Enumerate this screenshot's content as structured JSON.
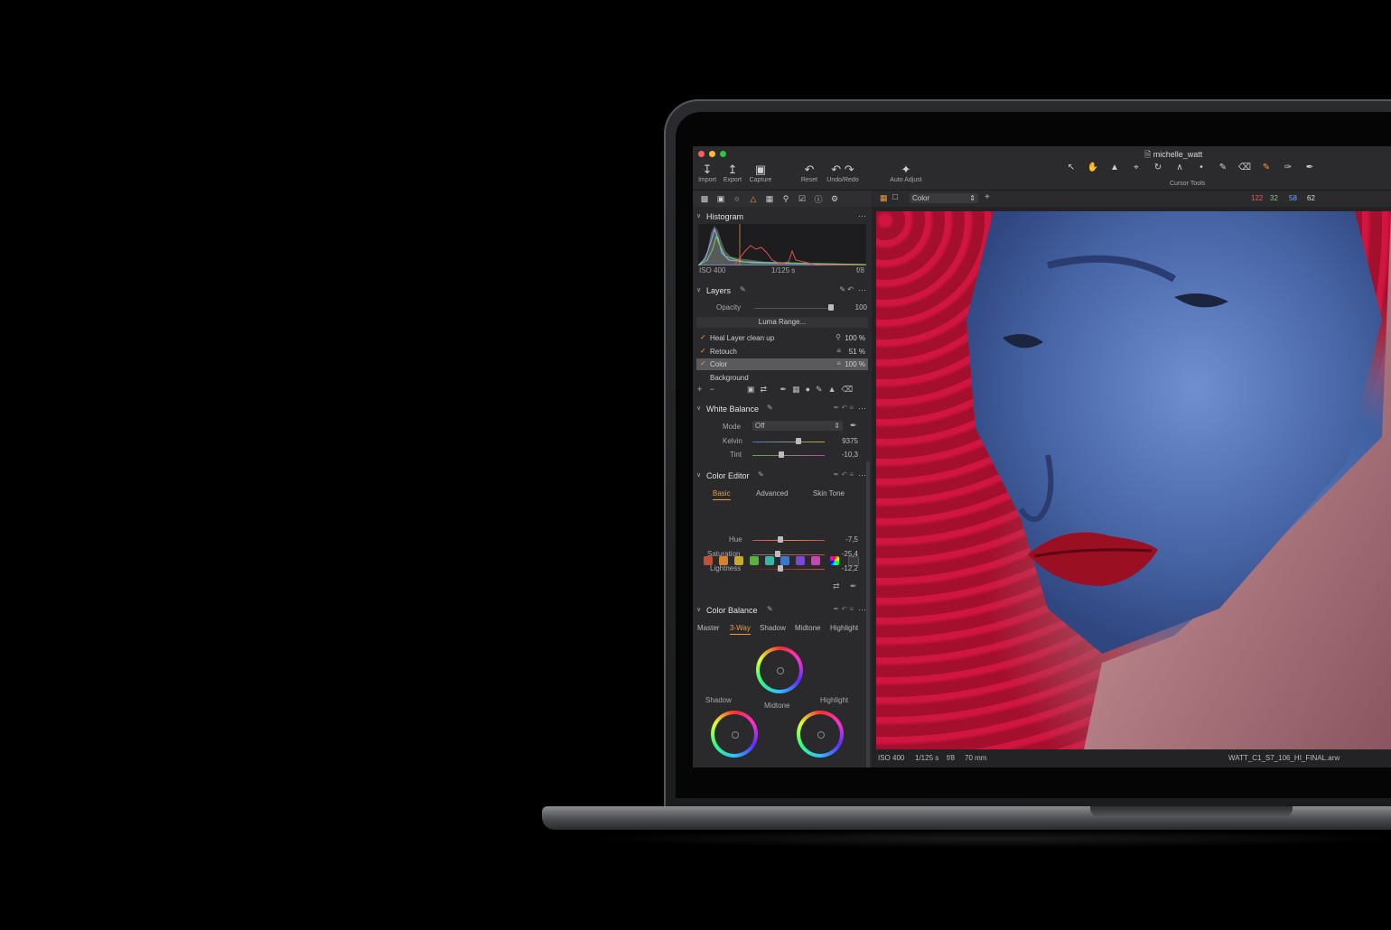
{
  "window": {
    "title": "michelle_watt"
  },
  "toolbar": {
    "import": "Import",
    "export": "Export",
    "capture": "Capture",
    "reset": "Reset",
    "undo_redo": "Undo/Redo",
    "auto_adjust": "Auto Adjust",
    "cursor_tools": "Cursor Tools"
  },
  "viewer": {
    "mode": "Color",
    "readout": {
      "r": "122",
      "g": "32",
      "b": "58",
      "l": "62"
    }
  },
  "histogram": {
    "title": "Histogram",
    "iso": "ISO 400",
    "shutter": "1/125 s",
    "aperture": "f/8"
  },
  "layers": {
    "title": "Layers",
    "opacity_label": "Opacity",
    "opacity_value": "100",
    "luma_range": "Luma Range...",
    "items": [
      {
        "name": "Heal Layer clean up",
        "value": "100 %"
      },
      {
        "name": "Retouch",
        "value": "51 %"
      },
      {
        "name": "Color",
        "value": "100 %"
      },
      {
        "name": "Background",
        "value": ""
      }
    ]
  },
  "white_balance": {
    "title": "White Balance",
    "mode_label": "Mode",
    "mode_value": "Off",
    "kelvin_label": "Kelvin",
    "kelvin_value": "9375",
    "tint_label": "Tint",
    "tint_value": "-10,3"
  },
  "color_editor": {
    "title": "Color Editor",
    "tabs": [
      "Basic",
      "Advanced",
      "Skin Tone"
    ],
    "hue_label": "Hue",
    "hue_value": "-7,5",
    "saturation_label": "Saturation",
    "saturation_value": "-25,4",
    "lightness_label": "Lightness",
    "lightness_value": "-12,2",
    "swatches": [
      "#c0503a",
      "#d9822c",
      "#c9a830",
      "#5bb040",
      "#37b6a4",
      "#3a78d0",
      "#7a4ad0",
      "#c04ab0"
    ]
  },
  "color_balance": {
    "title": "Color Balance",
    "tabs": [
      "Master",
      "3-Way",
      "Shadow",
      "Midtone",
      "Highlight"
    ],
    "shadow": "Shadow",
    "midtone": "Midtone",
    "highlight": "Highlight"
  },
  "status": {
    "iso": "ISO 400",
    "shutter": "1/125 s",
    "aperture": "f/8",
    "focal": "70 mm",
    "file": "WATT_C1_S7_106_HI_FINAL.arw"
  },
  "colors": {
    "accent": "#f29b38",
    "panel": "#2a2a2c"
  }
}
